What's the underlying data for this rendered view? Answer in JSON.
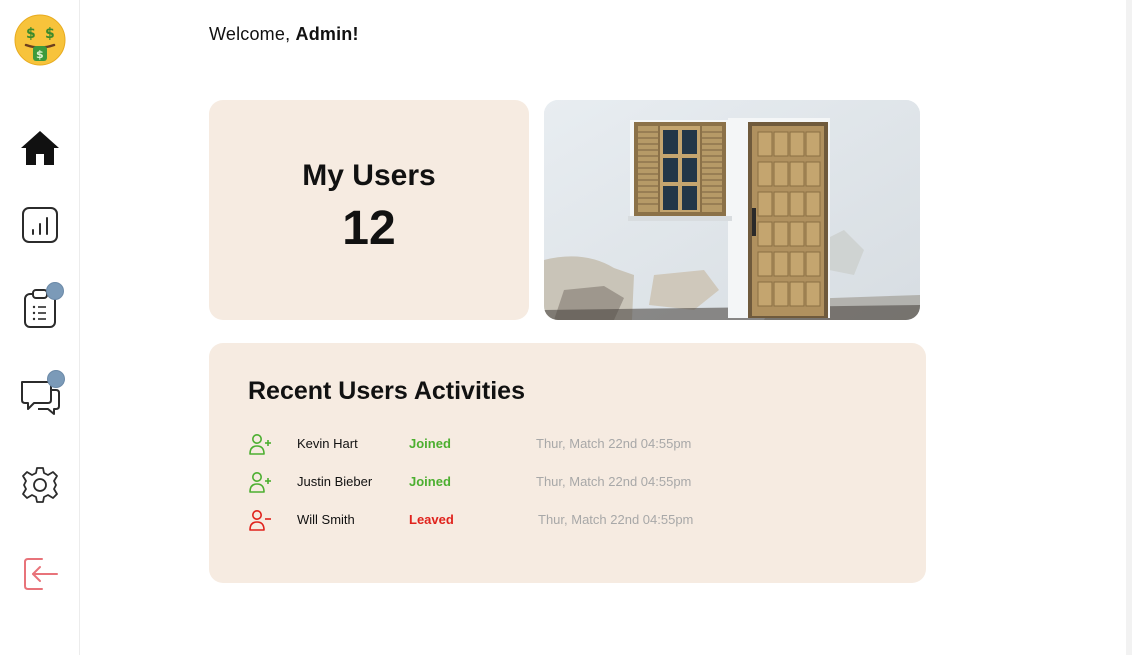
{
  "header": {
    "welcome_prefix": "Welcome, ",
    "user_name": "Admin!"
  },
  "sidebar": {
    "logo": "money-mouth-face-icon",
    "items": [
      {
        "icon": "home-icon",
        "active": true
      },
      {
        "icon": "bar-chart-icon",
        "active": false
      },
      {
        "icon": "clipboard-icon",
        "active": false,
        "has_notification": true
      },
      {
        "icon": "chat-icon",
        "active": false,
        "has_notification": true
      },
      {
        "icon": "gear-icon",
        "active": false
      },
      {
        "icon": "logout-icon",
        "active": false
      }
    ],
    "colors": {
      "active": "#111111",
      "inactive": "#2b2b2b",
      "logout": "#e8737a",
      "badge": "#7b9ab8"
    }
  },
  "users_card": {
    "title": "My Users",
    "count": "12"
  },
  "activity": {
    "title": "Recent Users Activities",
    "rows": [
      {
        "icon": "user-add-icon",
        "name": "Kevin Hart",
        "status": "Joined",
        "time": "Thur, Match 22nd 04:55pm"
      },
      {
        "icon": "user-add-icon",
        "name": "Justin Bieber",
        "status": "Joined",
        "time": "Thur, Match 22nd 04:55pm"
      },
      {
        "icon": "user-remove-icon",
        "name": "Will Smith",
        "status": "Leaved",
        "time": "Thur, Match 22nd 04:55pm"
      }
    ]
  },
  "colors": {
    "card_bg": "#f6ebe1",
    "joined": "#4caf30",
    "leaved": "#e0221c"
  }
}
